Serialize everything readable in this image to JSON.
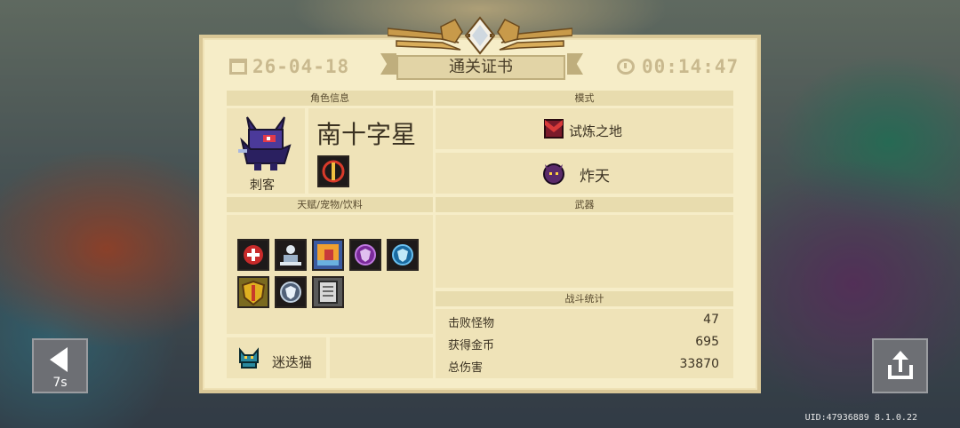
{
  "back": {
    "timer": "7s"
  },
  "uid_text": "UID:47936889 8.1.0.22",
  "certificate": {
    "title": "通关证书",
    "date": "26-04-18",
    "time": "00:14:47",
    "sections": {
      "character_info": "角色信息",
      "mode": "模式",
      "talents": "天赋/宠物/饮料",
      "weapons": "武器",
      "battle_stats": "战斗统计"
    },
    "character": {
      "name": "南十字星",
      "class": "刺客"
    },
    "mode": {
      "stage": "试炼之地",
      "difficulty": "炸天"
    },
    "pet": {
      "name": "迷迭猫"
    },
    "stats": [
      {
        "label": "击败怪物",
        "value": "47"
      },
      {
        "label": "获得金币",
        "value": "695"
      },
      {
        "label": "总伤害",
        "value": "33870"
      }
    ]
  },
  "colors": {
    "paper": "#f6edc8",
    "header": "#e8dcae",
    "text": "#3b3222",
    "gold": "#c9b98e"
  }
}
